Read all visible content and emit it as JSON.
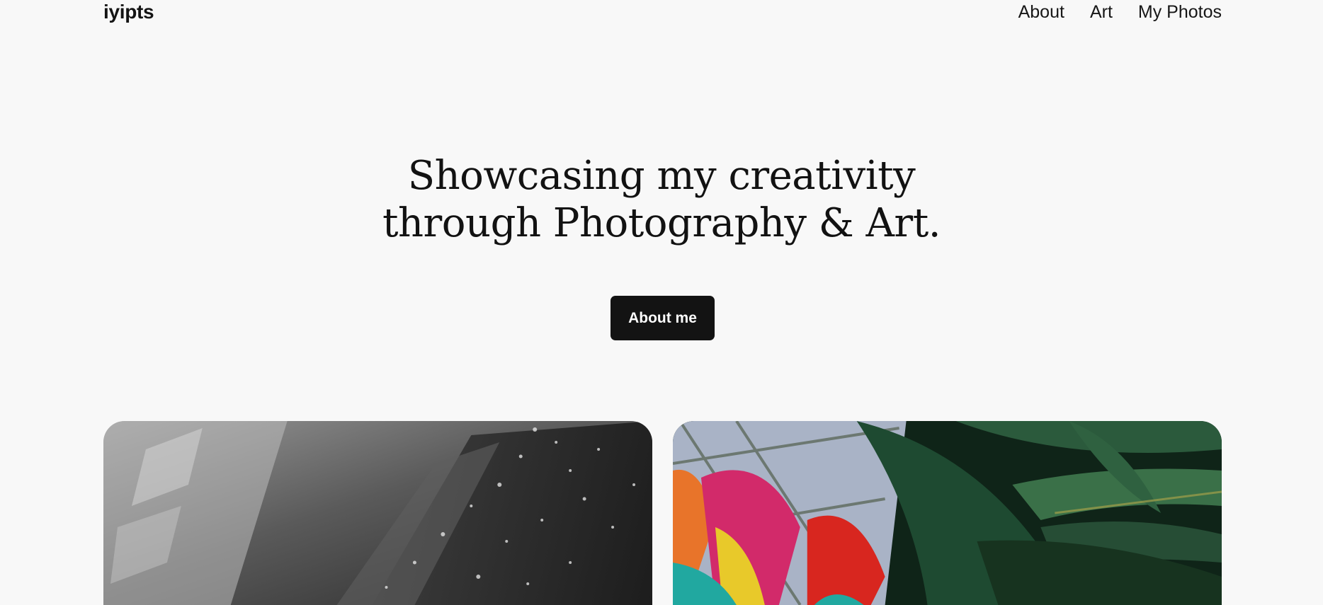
{
  "header": {
    "brand": "iyipts",
    "nav": [
      {
        "label": "About"
      },
      {
        "label": "Art"
      },
      {
        "label": "My Photos"
      }
    ]
  },
  "hero": {
    "title_line1": "Showcasing my creativity",
    "title_line2": "through Photography & Art.",
    "cta_label": "About me"
  },
  "gallery": {
    "photos": [
      {
        "subject": "black-and-white rain on glass"
      },
      {
        "subject": "colorful umbrellas behind green leaves"
      }
    ]
  },
  "colors": {
    "background": "#f8f8f8",
    "text": "#111111",
    "button_bg": "#131313",
    "button_text": "#ffffff"
  }
}
